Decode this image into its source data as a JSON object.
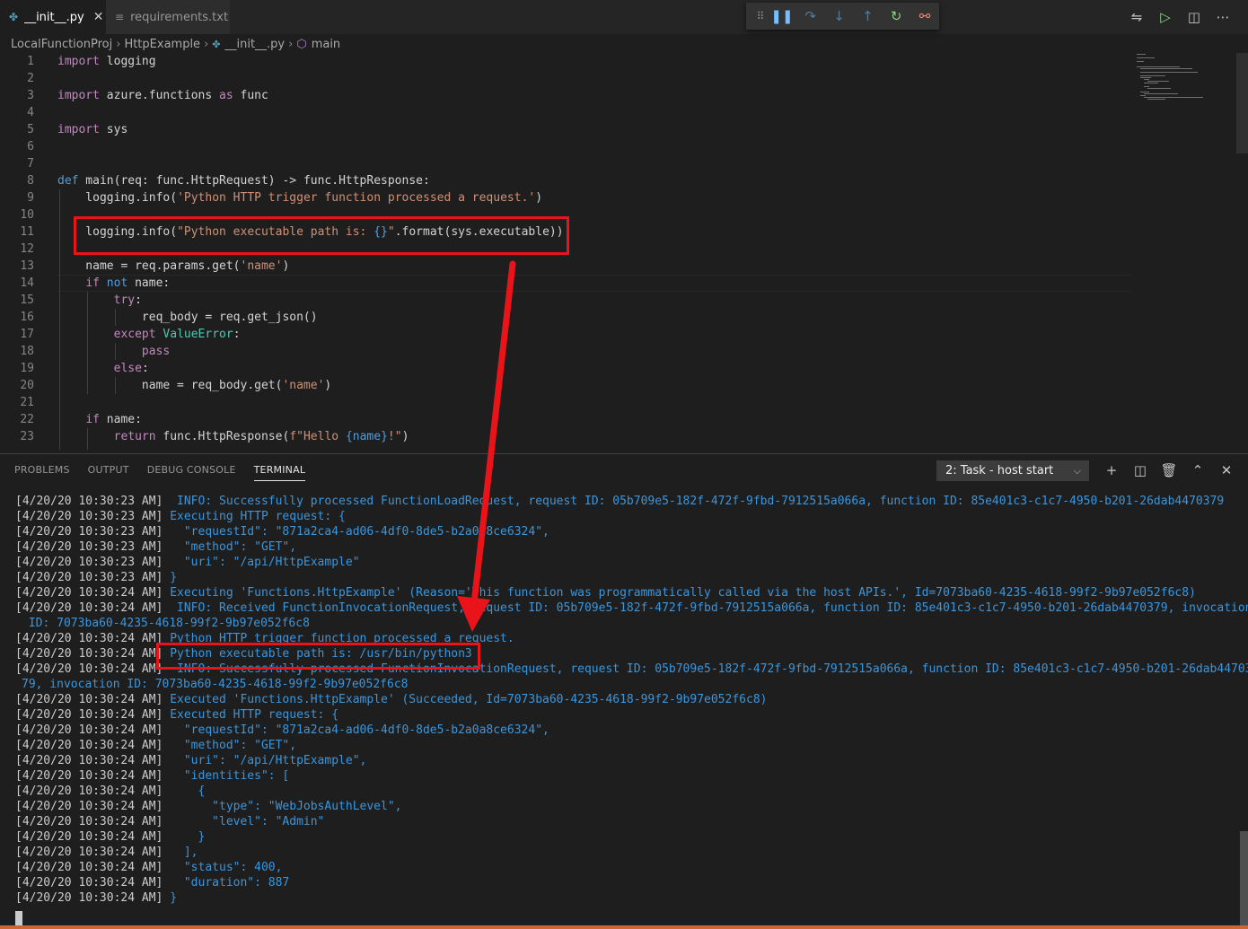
{
  "tabs": [
    {
      "label": "__init__.py",
      "icon": "python-file-icon",
      "active": true
    },
    {
      "label": "requirements.txt",
      "icon": "text-file-icon",
      "active": false
    }
  ],
  "breadcrumb": [
    "LocalFunctionProj",
    "HttpExample",
    "__init__.py",
    "main"
  ],
  "editor": {
    "lines": [
      {
        "n": "1"
      },
      {
        "n": "2"
      },
      {
        "n": "3"
      },
      {
        "n": "4"
      },
      {
        "n": "5"
      },
      {
        "n": "6"
      },
      {
        "n": "7"
      },
      {
        "n": "8"
      },
      {
        "n": "9"
      },
      {
        "n": "10"
      },
      {
        "n": "11"
      },
      {
        "n": "12"
      },
      {
        "n": "13"
      },
      {
        "n": "14"
      },
      {
        "n": "15"
      },
      {
        "n": "16"
      },
      {
        "n": "17"
      },
      {
        "n": "18"
      },
      {
        "n": "19"
      },
      {
        "n": "20"
      },
      {
        "n": "21"
      },
      {
        "n": "22"
      },
      {
        "n": "23"
      }
    ],
    "code": {
      "l1": {
        "k": "import",
        "t": " logging"
      },
      "l3": {
        "k": "import",
        "t": " azure.functions ",
        "k2": "as",
        "t2": " func"
      },
      "l5": {
        "k": "import",
        "t": " sys"
      },
      "l8": {
        "k": "def",
        "t": " main(req: func.HttpRequest) -> func.HttpResponse:"
      },
      "l9": {
        "t": "    logging.info(",
        "s": "'Python HTTP trigger function processed a request.'",
        "t2": ")"
      },
      "l11": {
        "t": "    logging.info(",
        "s": "\"Python executable path is: ",
        "b": "{}",
        "s2": "\"",
        "t2": ".format(sys.executable))"
      },
      "l13": {
        "t": "    name = req.params.get(",
        "s": "'name'",
        "t2": ")"
      },
      "l14": {
        "k": "if",
        "k2": "not",
        "t": " name:"
      },
      "l15": {
        "k": "try",
        "t": ":"
      },
      "l16": {
        "t": "            req_body = req.get_json()"
      },
      "l17": {
        "k": "except",
        "c": "ValueError",
        "t": ":"
      },
      "l18": {
        "k": "pass"
      },
      "l19": {
        "k": "else",
        "t": ":"
      },
      "l20": {
        "t": "            name = req_body.get(",
        "s": "'name'",
        "t2": ")"
      },
      "l22": {
        "k": "if",
        "t": " name:"
      },
      "l23": {
        "k": "return",
        "t": " func.HttpResponse(",
        "s": "f\"Hello ",
        "b": "{name}",
        "s2": "!\"",
        "t2": ")"
      }
    }
  },
  "panel": {
    "tabs": [
      "PROBLEMS",
      "OUTPUT",
      "DEBUG CONSOLE",
      "TERMINAL"
    ],
    "active_tab": "TERMINAL",
    "terminal_select": "2: Task - host start"
  },
  "terminal": {
    "lines": [
      {
        "ts": "[4/20/20 10:30:23 AM]",
        "msg": "  INFO: Successfully processed FunctionLoadRequest, request ID: 05b709e5-182f-472f-9fbd-7912515a066a, function ID: 85e401c3-c1c7-4950-b201-26dab4470379"
      },
      {
        "ts": "[4/20/20 10:30:23 AM]",
        "msg": " Executing HTTP request: {"
      },
      {
        "ts": "[4/20/20 10:30:23 AM]",
        "msg": "   \"requestId\": \"871a2ca4-ad06-4df0-8de5-b2a0a8ce6324\","
      },
      {
        "ts": "[4/20/20 10:30:23 AM]",
        "msg": "   \"method\": \"GET\","
      },
      {
        "ts": "[4/20/20 10:30:23 AM]",
        "msg": "   \"uri\": \"/api/HttpExample\""
      },
      {
        "ts": "[4/20/20 10:30:23 AM]",
        "msg": " }"
      },
      {
        "ts": "[4/20/20 10:30:24 AM]",
        "msg": " Executing 'Functions.HttpExample' (Reason='This function was programmatically called via the host APIs.', Id=7073ba60-4235-4618-99f2-9b97e052f6c8)"
      },
      {
        "ts": "[4/20/20 10:30:24 AM]",
        "msg": "  INFO: Received FunctionInvocationRequest, request ID: 05b709e5-182f-472f-9fbd-7912515a066a, function ID: 85e401c3-c1c7-4950-b201-26dab4470379, invocation"
      },
      {
        "ts": "",
        "msg": " ID: 7073ba60-4235-4618-99f2-9b97e052f6c8"
      },
      {
        "ts": "[4/20/20 10:30:24 AM]",
        "msg": " Python HTTP trigger function processed a request."
      },
      {
        "ts": "[4/20/20 10:30:24 AM]",
        "msg": " Python executable path is: /usr/bin/python3"
      },
      {
        "ts": "[4/20/20 10:30:24 AM]",
        "msg": "  INFO: Successfully processed FunctionInvocationRequest, request ID: 05b709e5-182f-472f-9fbd-7912515a066a, function ID: 85e401c3-c1c7-4950-b201-26dab44703"
      },
      {
        "ts": "",
        "msg": "79, invocation ID: 7073ba60-4235-4618-99f2-9b97e052f6c8"
      },
      {
        "ts": "[4/20/20 10:30:24 AM]",
        "msg": " Executed 'Functions.HttpExample' (Succeeded, Id=7073ba60-4235-4618-99f2-9b97e052f6c8)"
      },
      {
        "ts": "[4/20/20 10:30:24 AM]",
        "msg": " Executed HTTP request: {"
      },
      {
        "ts": "[4/20/20 10:30:24 AM]",
        "msg": "   \"requestId\": \"871a2ca4-ad06-4df0-8de5-b2a0a8ce6324\","
      },
      {
        "ts": "[4/20/20 10:30:24 AM]",
        "msg": "   \"method\": \"GET\","
      },
      {
        "ts": "[4/20/20 10:30:24 AM]",
        "msg": "   \"uri\": \"/api/HttpExample\","
      },
      {
        "ts": "[4/20/20 10:30:24 AM]",
        "msg": "   \"identities\": ["
      },
      {
        "ts": "[4/20/20 10:30:24 AM]",
        "msg": "     {"
      },
      {
        "ts": "[4/20/20 10:30:24 AM]",
        "msg": "       \"type\": \"WebJobsAuthLevel\","
      },
      {
        "ts": "[4/20/20 10:30:24 AM]",
        "msg": "       \"level\": \"Admin\""
      },
      {
        "ts": "[4/20/20 10:30:24 AM]",
        "msg": "     }"
      },
      {
        "ts": "[4/20/20 10:30:24 AM]",
        "msg": "   ],"
      },
      {
        "ts": "[4/20/20 10:30:24 AM]",
        "msg": "   \"status\": 400,"
      },
      {
        "ts": "[4/20/20 10:30:24 AM]",
        "msg": "   \"duration\": 887"
      },
      {
        "ts": "[4/20/20 10:30:24 AM]",
        "msg": " }"
      }
    ]
  },
  "colors": {
    "keyword": "#569cd6",
    "control": "#c586c0",
    "string": "#ce9178",
    "class": "#4ec9b0",
    "terminal_text": "#3a96dd",
    "annotation": "#e8141a"
  }
}
